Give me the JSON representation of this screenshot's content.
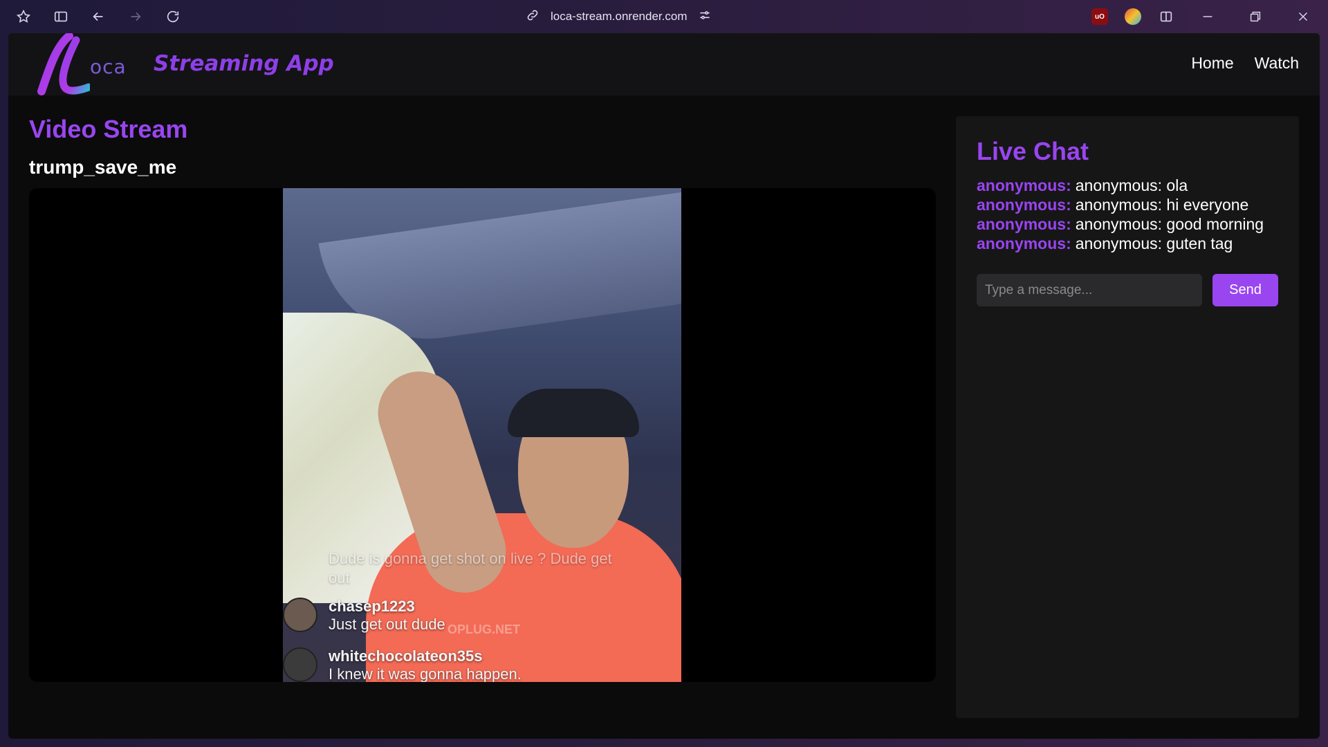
{
  "browser": {
    "url": "loca-stream.onrender.com"
  },
  "navbar": {
    "logo_text": "oca",
    "app_title": "Streaming App",
    "links": [
      "Home",
      "Watch"
    ]
  },
  "stream": {
    "section_title": "Video Stream",
    "name": "trump_save_me",
    "overlay_comments": [
      {
        "user": "",
        "text": "Dude is gonna get shot on live ? Dude get out"
      },
      {
        "user": "chasep1223",
        "text": "Just get out dude"
      },
      {
        "user": "whitechocolateon35s",
        "text": "I knew it was gonna happen."
      }
    ],
    "watermark": "OPLUG.NET"
  },
  "chat": {
    "title": "Live Chat",
    "messages": [
      {
        "author": "anonymous:",
        "text": "anonymous: ola"
      },
      {
        "author": "anonymous:",
        "text": "anonymous: hi everyone"
      },
      {
        "author": "anonymous:",
        "text": "anonymous: good morning"
      },
      {
        "author": "anonymous:",
        "text": "anonymous: guten tag"
      }
    ],
    "input_placeholder": "Type a message...",
    "send_label": "Send"
  },
  "colors": {
    "accent": "#9945f0",
    "page_bg": "#0b0b0c",
    "panel_bg": "#161617"
  }
}
